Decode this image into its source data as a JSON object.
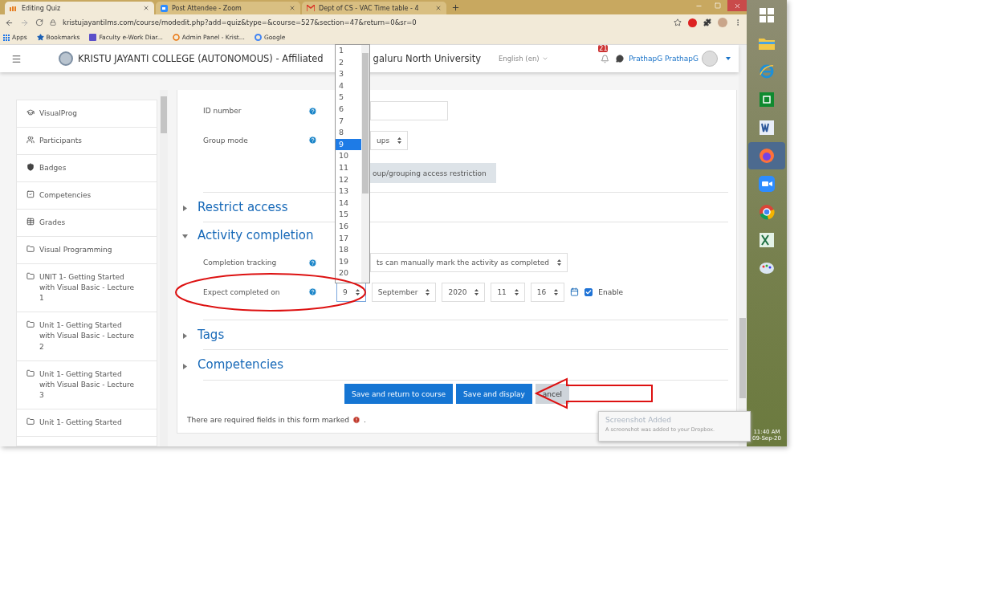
{
  "browser": {
    "tabs": [
      {
        "kind": "moodle",
        "title": "Editing Quiz",
        "selected": true
      },
      {
        "kind": "zoom",
        "title": "Post Attendee - Zoom",
        "selected": false
      },
      {
        "kind": "gmail",
        "title": "Dept of CS - VAC Time table - 4",
        "selected": false
      }
    ],
    "url": "kristujayantilms.com/course/modedit.php?add=quiz&type=&course=527&section=47&return=0&sr=0",
    "bookmarks": [
      {
        "kind": "apps",
        "label": "Apps"
      },
      {
        "kind": "star",
        "label": "Bookmarks"
      },
      {
        "kind": "square",
        "label": "Faculty e-Work Diar..."
      },
      {
        "kind": "ring",
        "label": "Admin Panel - Krist..."
      },
      {
        "kind": "google",
        "label": "Google"
      }
    ]
  },
  "navbar": {
    "site_name_start": "KRISTU JAYANTI COLLEGE (AUTONOMOUS) - Affiliated",
    "site_name_end": "galuru North University",
    "language": "English (en)",
    "notifications": "21",
    "user": "PrathapG PrathapG"
  },
  "sidebar": {
    "items": [
      {
        "kind": "course",
        "label": "VisualProg"
      },
      {
        "kind": "participants",
        "label": "Participants"
      },
      {
        "kind": "badges",
        "label": "Badges"
      },
      {
        "kind": "competencies",
        "label": "Competencies"
      },
      {
        "kind": "grades",
        "label": "Grades"
      },
      {
        "kind": "folder",
        "label": "Visual Programming"
      },
      {
        "kind": "folder",
        "label": "UNIT 1- Getting Started with Visual Basic - Lecture 1"
      },
      {
        "kind": "folder",
        "label": "Unit 1- Getting Started with Visual Basic - Lecture 2"
      },
      {
        "kind": "folder",
        "label": "Unit 1- Getting Started with Visual Basic - Lecture 3"
      },
      {
        "kind": "folder",
        "label": "Unit 1- Getting Started"
      }
    ]
  },
  "form": {
    "fields": [
      {
        "kind": "input",
        "label": "ID number"
      },
      {
        "kind": "select",
        "label": "Group mode",
        "value": "ups"
      },
      {
        "kind": "button",
        "label": "oup/grouping access restriction"
      }
    ],
    "sections": [
      {
        "title": "Restrict access",
        "expanded": false
      },
      {
        "title": "Activity completion",
        "expanded": true,
        "fields": [
          {
            "kind": "select",
            "label": "Completion tracking",
            "value": "ts can manually mark the activity as completed"
          },
          {
            "kind": "date",
            "label": "Expect completed on",
            "parts": [
              "9",
              "September",
              "2020",
              "11",
              "16"
            ],
            "enable_label": "Enable",
            "enabled": true
          }
        ]
      },
      {
        "title": "Tags",
        "expanded": false
      },
      {
        "title": "Competencies",
        "expanded": false
      }
    ],
    "buttons": [
      {
        "kind": "primary",
        "label": "Save and return to course"
      },
      {
        "kind": "primary",
        "label": "Save and display"
      },
      {
        "kind": "secondary",
        "label": "ancel"
      }
    ],
    "required_note": "There are required fields in this form marked",
    "required_note_end": "."
  },
  "day_dropdown": {
    "options": [
      {
        "label": "1",
        "selected": false
      },
      {
        "label": "2",
        "selected": false
      },
      {
        "label": "3",
        "selected": false
      },
      {
        "label": "4",
        "selected": false
      },
      {
        "label": "5",
        "selected": false
      },
      {
        "label": "6",
        "selected": false
      },
      {
        "label": "7",
        "selected": false
      },
      {
        "label": "8",
        "selected": false
      },
      {
        "label": "9",
        "selected": true
      },
      {
        "label": "10",
        "selected": false
      },
      {
        "label": "11",
        "selected": false
      },
      {
        "label": "12",
        "selected": false
      },
      {
        "label": "13",
        "selected": false
      },
      {
        "label": "14",
        "selected": false
      },
      {
        "label": "15",
        "selected": false
      },
      {
        "label": "16",
        "selected": false
      },
      {
        "label": "17",
        "selected": false
      },
      {
        "label": "18",
        "selected": false
      },
      {
        "label": "19",
        "selected": false
      },
      {
        "label": "20",
        "selected": false
      }
    ]
  },
  "notification": {
    "title": "Screenshot Added",
    "message": "A screenshot was added to your Dropbox."
  },
  "taskbar": {
    "apps": [
      {
        "kind": "start",
        "selected": false
      },
      {
        "kind": "explorer",
        "selected": false
      },
      {
        "kind": "ie",
        "selected": false
      },
      {
        "kind": "store",
        "selected": false
      },
      {
        "kind": "word",
        "selected": false
      },
      {
        "kind": "firefox",
        "selected": true
      },
      {
        "kind": "zoom",
        "selected": false
      },
      {
        "kind": "chrome",
        "selected": false
      },
      {
        "kind": "excel",
        "selected": false
      },
      {
        "kind": "paint",
        "selected": false
      }
    ],
    "time": "11:40 AM",
    "date": "09-Sep-20"
  }
}
